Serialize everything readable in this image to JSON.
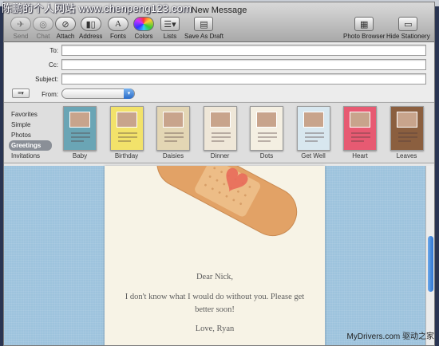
{
  "watermark": "陈鹏的个人网站 www.chenpeng123.com",
  "credit": "MyDrivers.com 驱动之家",
  "window": {
    "title": "New Message"
  },
  "toolbar": {
    "send": "Send",
    "chat": "Chat",
    "attach": "Attach",
    "address": "Address",
    "fonts": "Fonts",
    "colors": "Colors",
    "lists": "Lists",
    "save_draft": "Save As Draft",
    "photo_browser": "Photo Browser",
    "hide_stationery": "Hide Stationery"
  },
  "headers": {
    "to_label": "To:",
    "cc_label": "Cc:",
    "subject_label": "Subject:",
    "from_label": "From:",
    "to": "",
    "cc": "",
    "subject": "",
    "from": ""
  },
  "categories": [
    "Favorites",
    "Simple",
    "Photos",
    "Greetings",
    "Invitations"
  ],
  "selected_category": "Greetings",
  "stationery": [
    {
      "label": "Baby",
      "color": "#6aa5b5"
    },
    {
      "label": "Birthday",
      "color": "#f2e26a"
    },
    {
      "label": "Daisies",
      "color": "#e3d6b4"
    },
    {
      "label": "Dinner",
      "color": "#efe7d8"
    },
    {
      "label": "Dots",
      "color": "#f4efe2"
    },
    {
      "label": "Get Well",
      "color": "#d8e7ef"
    },
    {
      "label": "Heart",
      "color": "#e75a72"
    },
    {
      "label": "Leaves",
      "color": "#8b5f3f"
    }
  ],
  "letter": {
    "greeting": "Dear Nick,",
    "line1": "I don't know what I would do without you. Please get",
    "line2": "better soon!",
    "signoff": "Love, Ryan"
  },
  "colors": {
    "accent": "#2f74d0",
    "background": "#9dc3dd",
    "bandage": "#e3a46a"
  }
}
